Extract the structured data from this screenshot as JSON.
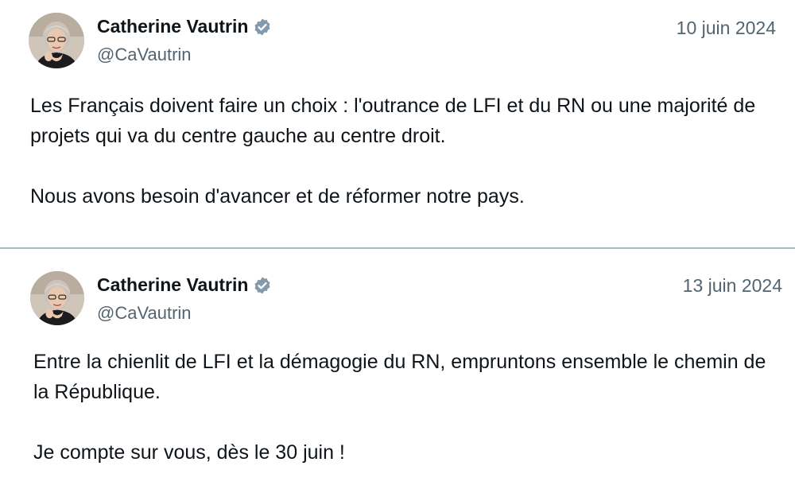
{
  "tweets": [
    {
      "author": {
        "display_name": "Catherine Vautrin",
        "handle": "@CaVautrin",
        "verified_icon": "verified-badge-icon",
        "avatar": "profile-photo"
      },
      "date": "10 juin 2024",
      "text": [
        "Les Français doivent faire un choix : l'outrance de LFI et du RN ou une majorité de projets qui va du centre gauche au centre droit.",
        "Nous avons besoin d'avancer et de réformer notre pays."
      ]
    },
    {
      "author": {
        "display_name": "Catherine Vautrin",
        "handle": "@CaVautrin",
        "verified_icon": "verified-badge-icon",
        "avatar": "profile-photo"
      },
      "date": "13 juin 2024",
      "text": [
        "Entre la chienlit de LFI et la démagogie du RN, empruntons ensemble le chemin de la République.",
        "Je compte sur vous, dès le 30 juin !"
      ]
    }
  ],
  "colors": {
    "text_primary": "#0f1419",
    "text_secondary": "#536471",
    "verified_badge": "#829aab",
    "divider": "#aab8c2"
  }
}
